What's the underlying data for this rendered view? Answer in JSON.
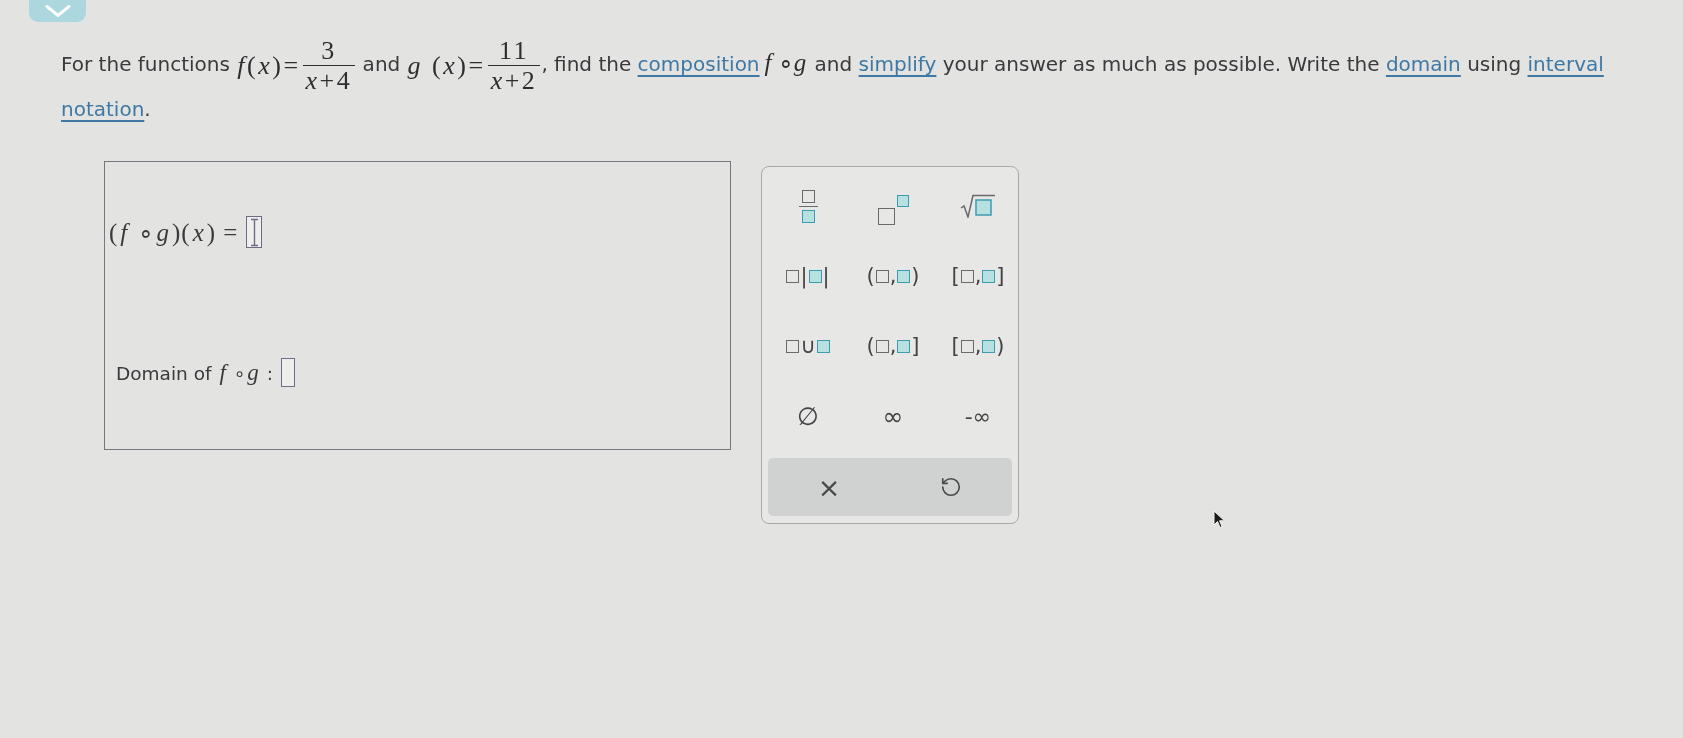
{
  "question": {
    "lines": [
      [
        {
          "kind": "text",
          "text": "For the functions "
        },
        {
          "kind": "formula",
          "lhs": "*f*(*x*)=",
          "numerator": "3",
          "denominator": "*x*+4"
        },
        {
          "kind": "text",
          "text": " and "
        },
        {
          "kind": "formula",
          "lhs": "*g* (*x*)=",
          "numerator": "11",
          "denominator": "*x*+2"
        },
        {
          "kind": "text",
          "text": ", find the "
        },
        {
          "kind": "link",
          "text": "composition"
        },
        {
          "kind": "math",
          "text": "*f* ∘*g*"
        },
        {
          "kind": "text",
          "text": " and "
        },
        {
          "kind": "link",
          "text": "simplify"
        },
        {
          "kind": "text",
          "text": " your answer as much as possible. Write the "
        },
        {
          "kind": "link",
          "text": "domain"
        },
        {
          "kind": "text",
          "text": " using "
        },
        {
          "kind": "link",
          "text": "interval"
        }
      ],
      [
        {
          "kind": "link",
          "text": "notation"
        },
        {
          "kind": "text",
          "text": "."
        }
      ]
    ]
  },
  "answer_area": {
    "rows": [
      {
        "kind": "formula",
        "label": "(*f* ∘*g*)(*x*) =",
        "focused": true
      },
      {
        "kind": "text",
        "label": "Domain of *f* ∘*g* :",
        "focused": false
      }
    ]
  },
  "keypad": {
    "keys": [
      {
        "kind": "fraction"
      },
      {
        "kind": "power"
      },
      {
        "kind": "sqrt"
      },
      {
        "kind": "abs",
        "left": "|",
        "right": "|"
      },
      {
        "kind": "interval",
        "left": "(",
        "separator": ",",
        "right": ")"
      },
      {
        "kind": "interval",
        "left": "[",
        "separator": ",",
        "right": "]"
      },
      {
        "kind": "union",
        "symbol": "∪"
      },
      {
        "kind": "interval",
        "left": "(",
        "separator": ",",
        "right": "]"
      },
      {
        "kind": "interval",
        "left": "[",
        "separator": ",",
        "right": ")"
      },
      {
        "kind": "symbol",
        "text": "∅"
      },
      {
        "kind": "symbol",
        "text": "∞"
      },
      {
        "kind": "symbol",
        "text": "-∞"
      }
    ],
    "actions": [
      {
        "kind": "clear",
        "text": "×"
      },
      {
        "kind": "undo"
      }
    ]
  }
}
